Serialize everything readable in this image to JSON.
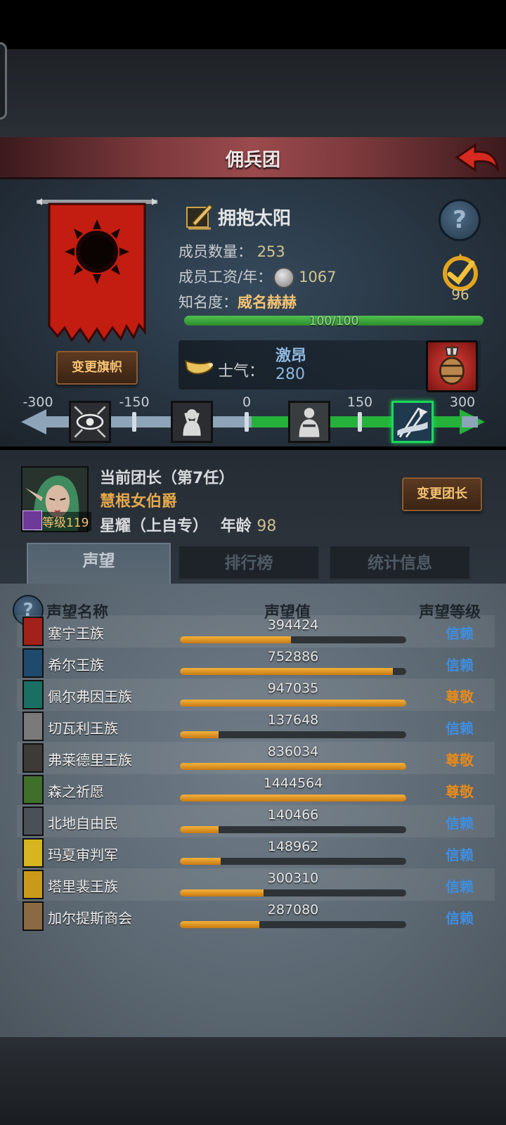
{
  "header": {
    "title": "佣兵团"
  },
  "guild": {
    "name": "拥抱太阳",
    "members_label": "成员数量：",
    "members_value": "253",
    "wage_label": "成员工资/年：",
    "wage_value": "1067",
    "fame_label": "知名度：",
    "fame_value": "威名赫赫",
    "fame_bar_text": "100/100",
    "fame_progress": 1.0,
    "badge_value": "96",
    "help": "?"
  },
  "banner": {
    "change_button": "变更旗帜"
  },
  "morale": {
    "label": "士气：",
    "state": "激昂",
    "value": "280",
    "progress_from_center": 0.93,
    "scale_labels": [
      "-300",
      "-150",
      "0",
      "150",
      "300"
    ]
  },
  "leader": {
    "title": "当前团长（第7任）",
    "name": "慧根女伯爵",
    "level_label": "等级119",
    "class_age": "星耀（上自专）",
    "age_label": "年龄",
    "age_value": "98",
    "change_button": "变更团长"
  },
  "tabs": [
    "声望",
    "排行榜",
    "统计信息"
  ],
  "reputation": {
    "help": "?",
    "headers": {
      "name": "声望名称",
      "value": "声望值",
      "level": "声望等级"
    },
    "rows": [
      {
        "name": "塞宁王族",
        "value": "394424",
        "fill": 0.49,
        "level": "信赖",
        "level_color": "#3f8ee0",
        "icon_color": "#a3211b"
      },
      {
        "name": "希尔王族",
        "value": "752886",
        "fill": 0.94,
        "level": "信赖",
        "level_color": "#3f8ee0",
        "icon_color": "#1f4a6e"
      },
      {
        "name": "佩尔弗因王族",
        "value": "947035",
        "fill": 1.0,
        "level": "尊敬",
        "level_color": "#e58a1c",
        "icon_color": "#1b6f62"
      },
      {
        "name": "切瓦利王族",
        "value": "137648",
        "fill": 0.17,
        "level": "信赖",
        "level_color": "#3f8ee0",
        "icon_color": "#7a7a7a"
      },
      {
        "name": "弗莱德里王族",
        "value": "836034",
        "fill": 1.0,
        "level": "尊敬",
        "level_color": "#e58a1c",
        "icon_color": "#3e3a37"
      },
      {
        "name": "森之祈愿",
        "value": "1444564",
        "fill": 1.0,
        "level": "尊敬",
        "level_color": "#e58a1c",
        "icon_color": "#3f6f2a"
      },
      {
        "name": "北地自由民",
        "value": "140466",
        "fill": 0.17,
        "level": "信赖",
        "level_color": "#3f8ee0",
        "icon_color": "#4a5058"
      },
      {
        "name": "玛夏审判军",
        "value": "148962",
        "fill": 0.18,
        "level": "信赖",
        "level_color": "#3f8ee0",
        "icon_color": "#d6b51e"
      },
      {
        "name": "塔里裴王族",
        "value": "300310",
        "fill": 0.37,
        "level": "信赖",
        "level_color": "#3f8ee0",
        "icon_color": "#c99a1a"
      },
      {
        "name": "加尔提斯商会",
        "value": "287080",
        "fill": 0.35,
        "level": "信赖",
        "level_color": "#3f8ee0",
        "icon_color": "#8a6a42"
      }
    ]
  }
}
